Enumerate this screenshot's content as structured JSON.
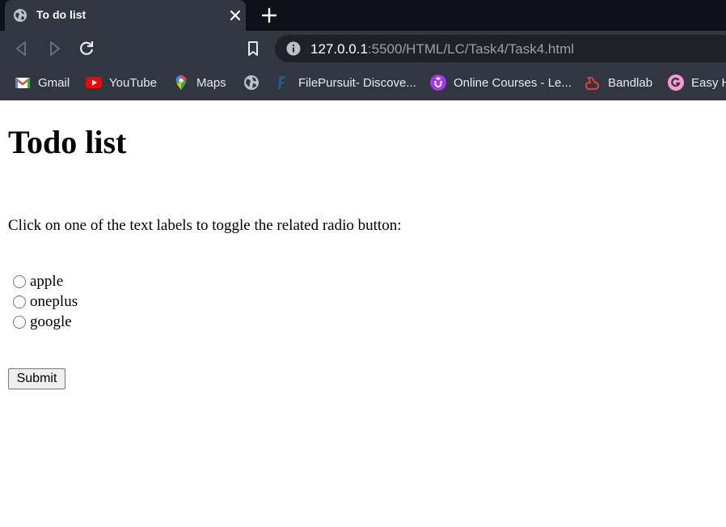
{
  "browser": {
    "tab": {
      "title": "To do list"
    },
    "address": {
      "host": "127.0.0.1",
      "rest": ":5500/HTML/LC/Task4/Task4.html"
    },
    "bookmarks": [
      {
        "label": "Gmail",
        "icon": "gmail-icon"
      },
      {
        "label": "YouTube",
        "icon": "youtube-icon"
      },
      {
        "label": "Maps",
        "icon": "maps-icon"
      },
      {
        "label": "",
        "icon": "globe-icon"
      },
      {
        "label": "FilePursuit- Discove...",
        "icon": "filepursuit-icon"
      },
      {
        "label": "Online Courses - Le...",
        "icon": "udemy-icon"
      },
      {
        "label": "Bandlab",
        "icon": "bandlab-icon"
      },
      {
        "label": "Easy H",
        "icon": "grammarly-icon"
      }
    ]
  },
  "page": {
    "title": "Todo list",
    "instruction": "Click on one of the text labels to toggle the related radio button:",
    "options": [
      "apple",
      "oneplus",
      "google"
    ],
    "submit_label": "Submit"
  },
  "colors": {
    "tabstrip": "#0f111a",
    "toolbar": "#323640",
    "omnibox": "#1f2128"
  }
}
